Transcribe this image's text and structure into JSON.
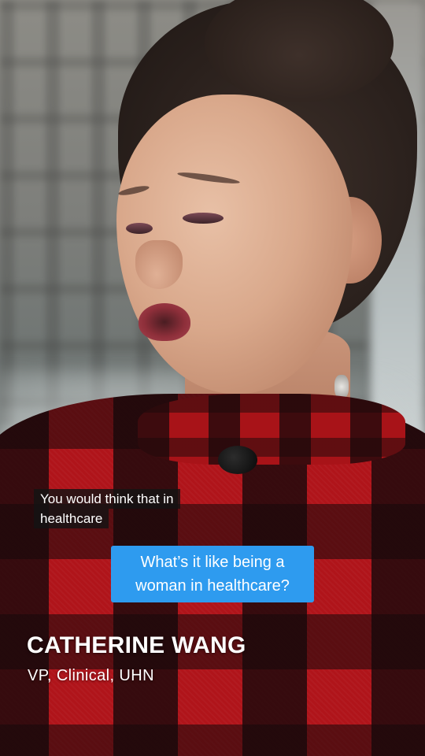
{
  "caption": {
    "lines": [
      "You would think that in",
      "healthcare"
    ]
  },
  "question": {
    "text": "What’s it like being a woman in healthcare?"
  },
  "speaker": {
    "name": "CATHERINE WANG",
    "title": "VP, Clinical, UHN"
  },
  "colors": {
    "question_bubble": "#2e9bef",
    "caption_background": "#141414",
    "text": "#ffffff"
  }
}
